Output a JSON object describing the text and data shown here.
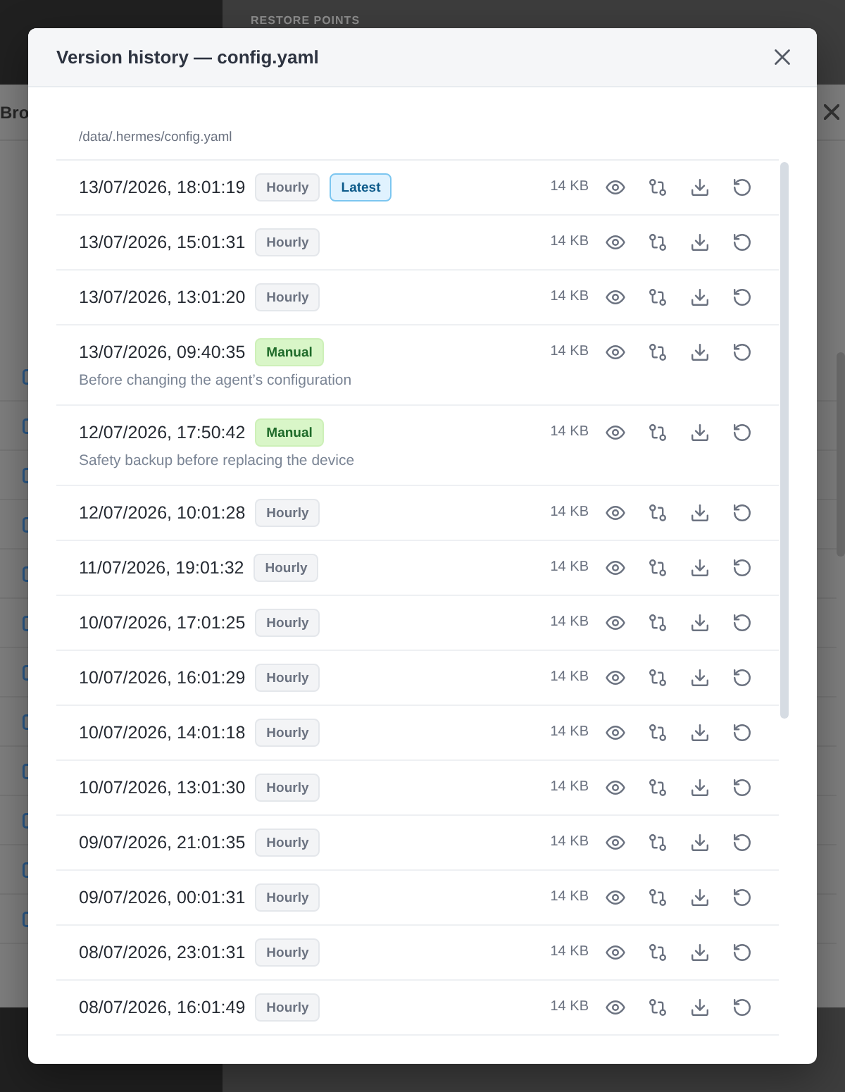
{
  "background": {
    "section_label": "RESTORE POINTS",
    "dialog_title": "Bro",
    "checkboxes": [
      {
        "checked": false
      },
      {
        "checked": false
      },
      {
        "checked": false
      },
      {
        "checked": false
      },
      {
        "checked": false
      },
      {
        "checked": false
      },
      {
        "checked": false
      },
      {
        "checked": false
      },
      {
        "checked": false
      },
      {
        "checked": false
      },
      {
        "checked": false
      },
      {
        "checked": false
      }
    ]
  },
  "dialog": {
    "title": "Version history — config.yaml",
    "path": "/data/.hermes/config.yaml",
    "versions": [
      {
        "timestamp": "13/07/2026, 18:01:19",
        "badges": [
          {
            "kind": "hourly",
            "label": "Hourly"
          },
          {
            "kind": "latest",
            "label": "Latest"
          }
        ],
        "size": "14 KB"
      },
      {
        "timestamp": "13/07/2026, 15:01:31",
        "badges": [
          {
            "kind": "hourly",
            "label": "Hourly"
          }
        ],
        "size": "14 KB"
      },
      {
        "timestamp": "13/07/2026, 13:01:20",
        "badges": [
          {
            "kind": "hourly",
            "label": "Hourly"
          }
        ],
        "size": "14 KB"
      },
      {
        "timestamp": "13/07/2026, 09:40:35",
        "badges": [
          {
            "kind": "manual",
            "label": "Manual"
          }
        ],
        "note": "Before changing the agent’s configuration",
        "size": "14 KB"
      },
      {
        "timestamp": "12/07/2026, 17:50:42",
        "badges": [
          {
            "kind": "manual",
            "label": "Manual"
          }
        ],
        "note": "Safety backup before replacing the device",
        "size": "14 KB"
      },
      {
        "timestamp": "12/07/2026, 10:01:28",
        "badges": [
          {
            "kind": "hourly",
            "label": "Hourly"
          }
        ],
        "size": "14 KB"
      },
      {
        "timestamp": "11/07/2026, 19:01:32",
        "badges": [
          {
            "kind": "hourly",
            "label": "Hourly"
          }
        ],
        "size": "14 KB"
      },
      {
        "timestamp": "10/07/2026, 17:01:25",
        "badges": [
          {
            "kind": "hourly",
            "label": "Hourly"
          }
        ],
        "size": "14 KB"
      },
      {
        "timestamp": "10/07/2026, 16:01:29",
        "badges": [
          {
            "kind": "hourly",
            "label": "Hourly"
          }
        ],
        "size": "14 KB"
      },
      {
        "timestamp": "10/07/2026, 14:01:18",
        "badges": [
          {
            "kind": "hourly",
            "label": "Hourly"
          }
        ],
        "size": "14 KB"
      },
      {
        "timestamp": "10/07/2026, 13:01:30",
        "badges": [
          {
            "kind": "hourly",
            "label": "Hourly"
          }
        ],
        "size": "14 KB"
      },
      {
        "timestamp": "09/07/2026, 21:01:35",
        "badges": [
          {
            "kind": "hourly",
            "label": "Hourly"
          }
        ],
        "size": "14 KB"
      },
      {
        "timestamp": "09/07/2026, 00:01:31",
        "badges": [
          {
            "kind": "hourly",
            "label": "Hourly"
          }
        ],
        "size": "14 KB"
      },
      {
        "timestamp": "08/07/2026, 23:01:31",
        "badges": [
          {
            "kind": "hourly",
            "label": "Hourly"
          }
        ],
        "size": "14 KB"
      },
      {
        "timestamp": "08/07/2026, 16:01:49",
        "badges": [
          {
            "kind": "hourly",
            "label": "Hourly"
          }
        ],
        "size": "14 KB"
      }
    ]
  }
}
